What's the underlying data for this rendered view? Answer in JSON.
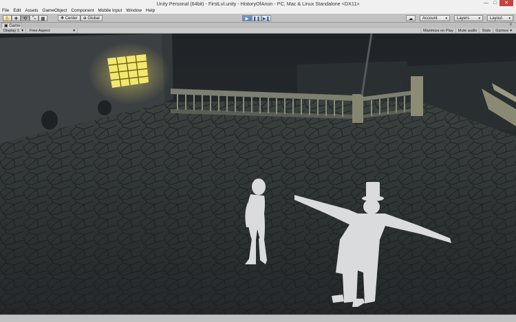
{
  "window": {
    "title": "Unity Personal (64bit) - FirstLvl.unity - HistoryOfAnon - PC, Mac & Linux Standalone <DX11>",
    "minimize_glyph": "—",
    "maximize_glyph": "□",
    "close_glyph": "✕"
  },
  "menu": [
    "File",
    "Edit",
    "Assets",
    "GameObject",
    "Component",
    "Mobile Input",
    "Window",
    "Help"
  ],
  "toolbar": {
    "tools": [
      {
        "name": "hand-tool",
        "glyph": "✋"
      },
      {
        "name": "move-tool",
        "glyph": "✥"
      },
      {
        "name": "rotate-tool",
        "glyph": "⟲"
      },
      {
        "name": "scale-tool",
        "glyph": "⤡"
      },
      {
        "name": "rect-tool",
        "glyph": "▦"
      }
    ],
    "pivot_label": "Center",
    "pivot_glyph": "✥",
    "space_label": "Global",
    "space_glyph": "⊕",
    "play_glyph": "▶",
    "pause_glyph": "❚❚",
    "step_glyph": "▶❚",
    "cloud_glyph": "☁",
    "account_label": "Account",
    "layers_label": "Layers",
    "layout_label": "Layout",
    "caret": "▾"
  },
  "game_tab": {
    "label": "Game",
    "icon_glyph": "▣",
    "menu_glyph": "≡",
    "display_label": "Display 1",
    "aspect_label": "Free Aspect",
    "maximize_label": "Maximize on Play",
    "mute_label": "Mute audio",
    "stats_label": "Stats",
    "gizmos_label": "Gizmos"
  },
  "colors": {
    "window_glow": "#f2e46a",
    "wall": "#3c4043",
    "ground": "#2c3134",
    "character": "#d9dbdc"
  }
}
